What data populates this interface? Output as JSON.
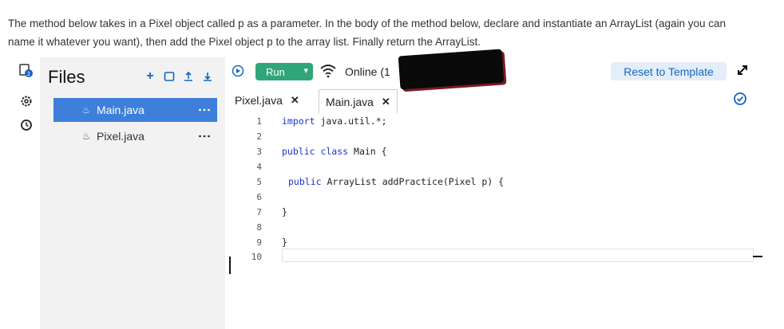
{
  "instructions": "The method below takes in a Pixel object called p as a parameter. In the body of the method below, declare and instantiate an ArrayList (again you can name it whatever you want), then add the Pixel object p to the array list. Finally return the ArrayList.",
  "files": {
    "title": "Files",
    "actions": [
      "add-file-icon",
      "new-folder-icon",
      "upload-icon",
      "download-icon"
    ],
    "items": [
      {
        "name": "Main.java",
        "active": true
      },
      {
        "name": "Pixel.java",
        "active": false
      }
    ]
  },
  "rail_icons": [
    "logo-icon",
    "gear-icon",
    "clock-icon"
  ],
  "toolbar": {
    "run_label": "Run",
    "online_text": "Online (1",
    "reset_label": "Reset to Template",
    "accent_color": "#2ea67a",
    "link_color": "#1565c0"
  },
  "tabs": [
    {
      "label": "Pixel.java",
      "active": false
    },
    {
      "label": "Main.java",
      "active": true
    }
  ],
  "code": {
    "line_numbers": [
      "1",
      "2",
      "3",
      "4",
      "5",
      "6",
      "7",
      "8",
      "9",
      "10"
    ],
    "lines": [
      {
        "kw": "import",
        "rest": " java.util.*;"
      },
      {
        "kw": "",
        "rest": ""
      },
      {
        "kw": "public class",
        "rest": " Main {"
      },
      {
        "kw": "",
        "rest": ""
      },
      {
        "kw": "public",
        "rest": " ArrayList addPractice(Pixel p) {"
      },
      {
        "kw": "",
        "rest": ""
      },
      {
        "kw": "",
        "rest": "}"
      },
      {
        "kw": "",
        "rest": ""
      },
      {
        "kw": "",
        "rest": "}"
      },
      {
        "kw": "",
        "rest": ""
      }
    ]
  }
}
